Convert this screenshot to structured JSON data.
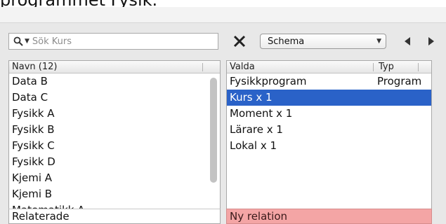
{
  "header": {
    "title_text": "programmet Fysik."
  },
  "search": {
    "placeholder": "Sök Kurs"
  },
  "toolbar": {
    "view_select_value": "Schema"
  },
  "left_list": {
    "column_header": "Navn (12)",
    "items": [
      "Data B",
      "Data C",
      "Fysikk A",
      "Fysikk B",
      "Fysikk C",
      "Fysikk D",
      "Kjemi A",
      "Kjemi B",
      "Matematikk A"
    ],
    "footer_label": "Relaterade"
  },
  "right_list": {
    "column_headers": [
      "Valda",
      "Typ"
    ],
    "rows": [
      {
        "name": "Fysikkprogram",
        "type": "Program"
      },
      {
        "name": "Kurs x 1",
        "type": ""
      },
      {
        "name": "Moment x 1",
        "type": ""
      },
      {
        "name": "Lärare x 1",
        "type": ""
      },
      {
        "name": "Lokal x 1",
        "type": ""
      }
    ],
    "selected_index": 1,
    "footer_label": "Ny relation"
  },
  "colors": {
    "selection": "#2a62c8",
    "footer_alert": "#f4a5a5"
  },
  "icons": [
    "search-icon",
    "dropdown-caret-icon",
    "close-x-icon",
    "chevron-down-icon",
    "arrow-left-icon",
    "arrow-right-icon"
  ]
}
